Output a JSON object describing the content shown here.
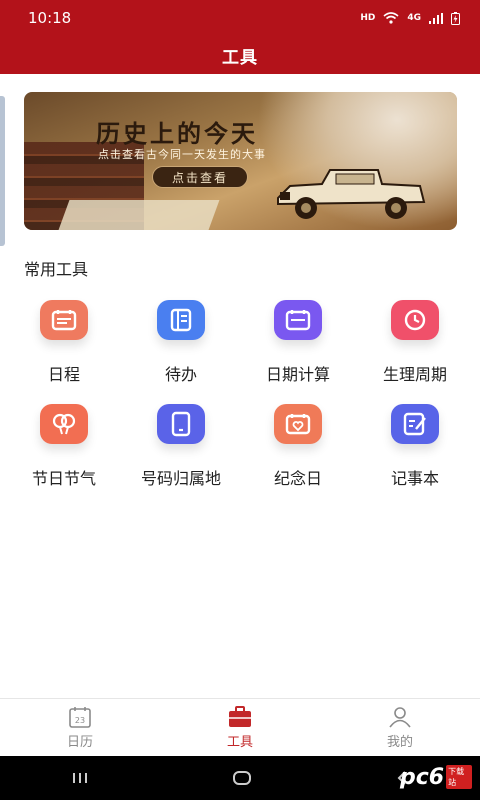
{
  "status_bar": {
    "time": "10:18",
    "hd": "HD",
    "signal_label": "4G"
  },
  "header": {
    "title": "工具"
  },
  "banner": {
    "title": "历史上的今天",
    "subtitle": "点击查看古今同一天发生的大事",
    "button_label": "点击查看"
  },
  "section": {
    "title": "常用工具"
  },
  "tools": [
    {
      "label": "日程",
      "icon": "calendar-icon",
      "color": "#ef7a5f"
    },
    {
      "label": "待办",
      "icon": "notebook-icon",
      "color": "#4a7ff0"
    },
    {
      "label": "日期计算",
      "icon": "calendar-icon",
      "color": "#7a58f0"
    },
    {
      "label": "生理周期",
      "icon": "clock-icon",
      "color": "#f0506a"
    },
    {
      "label": "节日节气",
      "icon": "balloon-icon",
      "color": "#f26e52"
    },
    {
      "label": "号码归属地",
      "icon": "tablet-icon",
      "color": "#5a63e8"
    },
    {
      "label": "纪念日",
      "icon": "heart-calendar-icon",
      "color": "#f07a58"
    },
    {
      "label": "记事本",
      "icon": "edit-note-icon",
      "color": "#5864e8"
    }
  ],
  "tab_bar": {
    "calendar_label": "日历",
    "calendar_day": "23",
    "tools_label": "工具",
    "mine_label": "我的",
    "active_color": "#c2282a"
  },
  "watermark": {
    "logo": "pc6",
    "tag": "下载站"
  }
}
